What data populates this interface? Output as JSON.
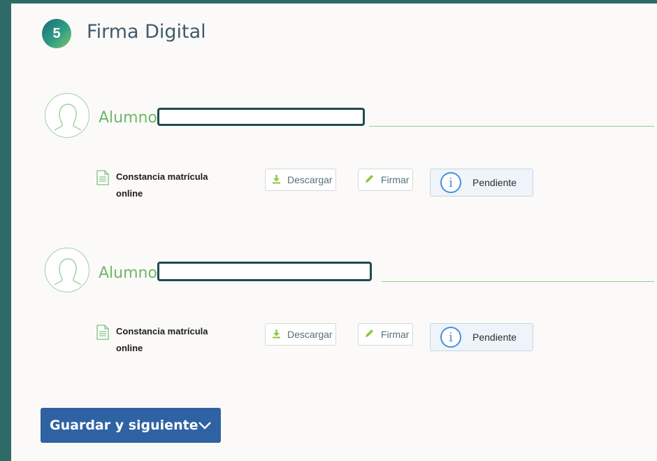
{
  "step": {
    "number": "5",
    "title": "Firma Digital"
  },
  "students": [
    {
      "label": "Alumno",
      "document": {
        "title": "Constancia matrícula online"
      },
      "actions": {
        "download": "Descargar",
        "sign": "Firmar"
      },
      "status": "Pendiente"
    },
    {
      "label": "Alumno",
      "document": {
        "title": "Constancia matrícula online"
      },
      "actions": {
        "download": "Descargar",
        "sign": "Firmar"
      },
      "status": "Pendiente"
    }
  ],
  "footer": {
    "save_label": "Guardar y siguiente"
  },
  "colors": {
    "accent_green": "#6fb86c",
    "primary_blue": "#2f62a3",
    "info_blue": "#4a90d9"
  },
  "icons": [
    "user-avatar-icon",
    "document-icon",
    "download-icon",
    "pencil-icon",
    "info-icon",
    "chevron-down-icon"
  ]
}
